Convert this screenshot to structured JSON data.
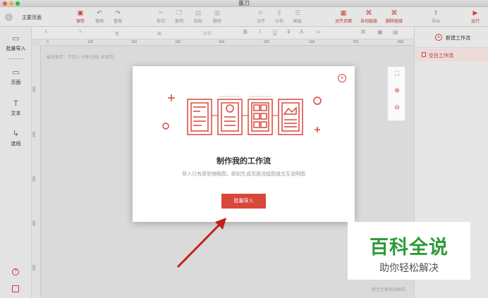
{
  "app": {
    "title": "墨刀"
  },
  "header": {
    "breadcrumb": "主要页面"
  },
  "toolbar": {
    "save": "保存",
    "undo": "撤销",
    "redo": "重做",
    "cut": "剪切",
    "copy": "复制",
    "paste": "粘贴",
    "delete": "删除",
    "align": "对齐",
    "distribute": "分布",
    "layer": "图层",
    "align_page": "对齐页面",
    "auto_link": "自动链接",
    "delete_link": "删除链接",
    "export": "导出",
    "run": "运行"
  },
  "leftbar": {
    "batch_import": "批量导入",
    "page": "页面",
    "text": "文本",
    "connector": "连线"
  },
  "props": {
    "x": "X",
    "y": "Y",
    "width": "宽",
    "height": "高",
    "font_size": "字号"
  },
  "ruler": {
    "h_ticks": [
      "0",
      "100",
      "200",
      "300",
      "400",
      "500",
      "600",
      "700",
      "800"
    ],
    "v_ticks": [
      "100",
      "200",
      "300",
      "400",
      "500"
    ]
  },
  "canvas": {
    "autosave": "最后保存：不到 1 分钟之前( 未保存)",
    "hint": "按住空格拖动画布"
  },
  "rightpanel": {
    "new_flow": "新建工作流",
    "flow_item": "空白工作流"
  },
  "modal": {
    "title": "制作我的工作流",
    "desc": "导入已有原型缩略图，即刻生成页面流程图或交互说明图",
    "button": "批量导入"
  },
  "watermark": {
    "brand": "百科全说",
    "slogan": "助你轻松解决"
  },
  "colors": {
    "accent": "#d9473b",
    "brand_green": "#2d9b39"
  },
  "icons": {
    "save": "save-icon",
    "undo": "undo-icon",
    "redo": "redo-icon",
    "cut": "scissors-icon",
    "copy": "copy-icon",
    "paste": "paste-icon",
    "delete": "trash-icon",
    "zoom_in": "zoom-in-icon",
    "zoom_out": "zoom-out-icon",
    "fit": "fit-screen-icon",
    "close": "close-icon",
    "help": "help-icon"
  }
}
